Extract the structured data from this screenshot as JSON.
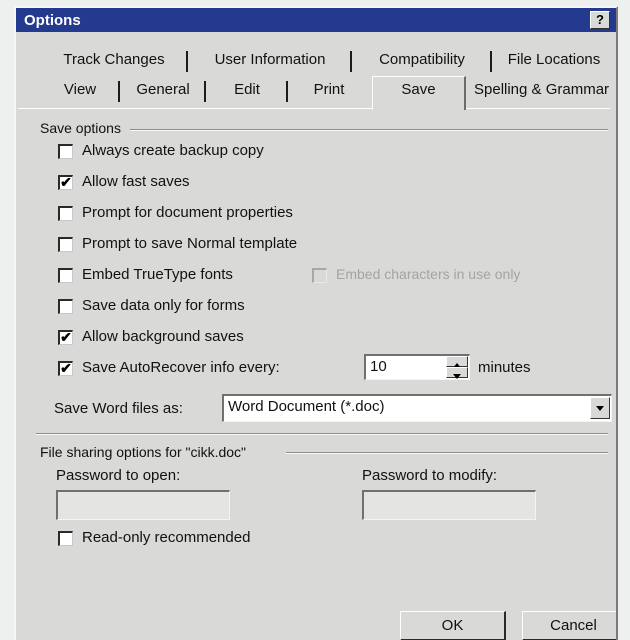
{
  "window": {
    "title": "Options",
    "help_label": "?"
  },
  "tabs": {
    "row_back": [
      "Track Changes",
      "User Information",
      "Compatibility",
      "File Locations"
    ],
    "row_front": [
      "View",
      "General",
      "Edit",
      "Print",
      "Save",
      "Spelling & Grammar"
    ],
    "active": "Save"
  },
  "save_options": {
    "group_label": "Save options",
    "items": [
      {
        "label": "Always create backup copy",
        "checked": false
      },
      {
        "label": "Allow fast saves",
        "checked": true
      },
      {
        "label": "Prompt for document properties",
        "checked": false
      },
      {
        "label": "Prompt to save Normal template",
        "checked": false
      },
      {
        "label": "Embed TrueType fonts",
        "checked": false
      },
      {
        "label": "Save data only for forms",
        "checked": false
      },
      {
        "label": "Allow background saves",
        "checked": true
      },
      {
        "label": "Save AutoRecover info every:",
        "checked": true
      }
    ],
    "embed_chars": {
      "label": "Embed characters in use only",
      "checked": false,
      "disabled": true
    },
    "autorecover_value": "10",
    "autorecover_unit": "minutes",
    "save_as_label": "Save Word files as:",
    "save_as_value": "Word Document (*.doc)"
  },
  "file_sharing": {
    "group_label": "File sharing options for \"cikk.doc\"",
    "password_open_label": "Password to open:",
    "password_modify_label": "Password to modify:",
    "password_open_value": "",
    "password_modify_value": "",
    "readonly_label": "Read-only recommended",
    "readonly_checked": false
  },
  "buttons": {
    "ok": "OK",
    "cancel": "Cancel"
  },
  "check_glyph": "✔"
}
